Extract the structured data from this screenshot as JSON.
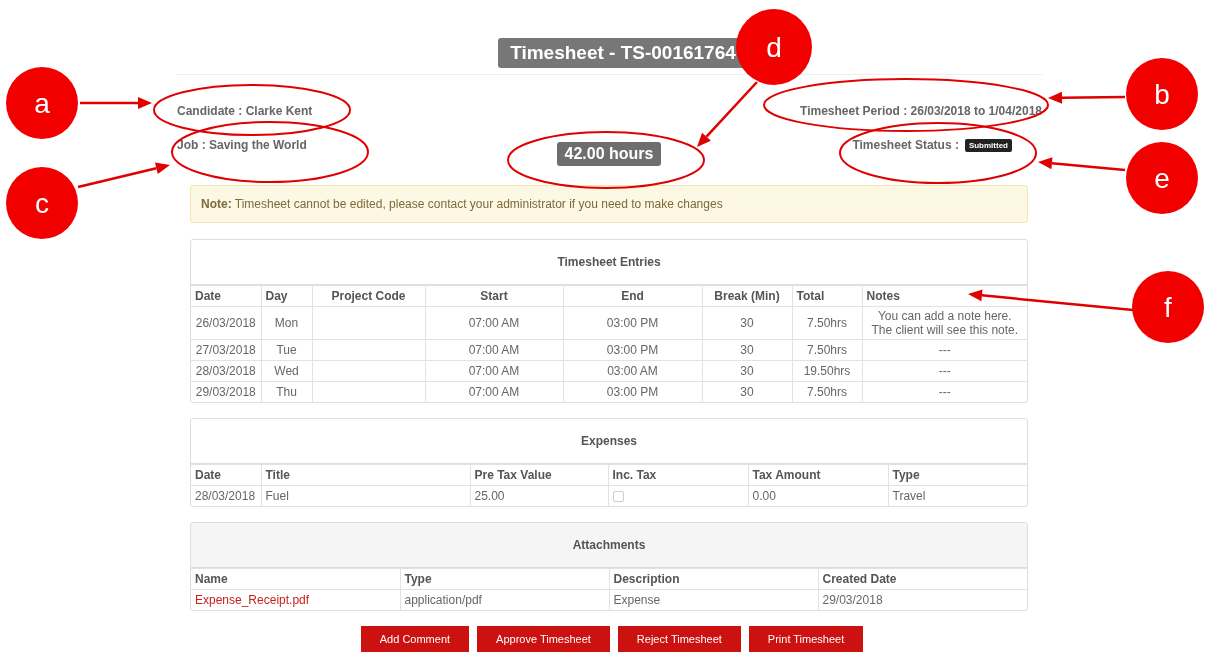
{
  "title": "Timesheet - TS-00161764",
  "candidate": "Candidate : Clarke Kent",
  "job": "Job : Saving the World",
  "period": "Timesheet Period :  26/03/2018 to 1/04/2018",
  "hours": "42.00 hours",
  "status": {
    "label": "Timesheet Status :",
    "badge": "Submitted"
  },
  "note": "**Note:** Timesheet cannot be edited, please contact your administrator if you need to make changes",
  "entries": {
    "title": "Timesheet Entries",
    "columns": [
      "Date",
      "Day",
      "Project Code",
      "Start",
      "End",
      "Break (Min)",
      "Total",
      "Notes"
    ],
    "rows": [
      [
        "26/03/2018",
        "Mon",
        "",
        "07:00 AM",
        "03:00 PM",
        "30",
        "7.50hrs",
        "You can add a note here.\nThe client will see this note."
      ],
      [
        "27/03/2018",
        "Tue",
        "",
        "07:00 AM",
        "03:00 PM",
        "30",
        "7.50hrs",
        "---"
      ],
      [
        "28/03/2018",
        "Wed",
        "",
        "07:00 AM",
        "03:00 AM",
        "30",
        "19.50hrs",
        "---"
      ],
      [
        "29/03/2018",
        "Thu",
        "",
        "07:00 AM",
        "03:00 PM",
        "30",
        "7.50hrs",
        "---"
      ]
    ]
  },
  "expenses": {
    "title": "Expenses",
    "columns": [
      "Date",
      "Title",
      "Pre Tax Value",
      "Inc. Tax",
      "Tax Amount",
      "Type"
    ],
    "rows": [
      {
        "date": "28/03/2018",
        "title": "Fuel",
        "pre_tax_value": "25.00",
        "inc_tax": false,
        "tax_amount": "0.00",
        "type": "Travel"
      }
    ]
  },
  "attachments": {
    "title": "Attachments",
    "columns": [
      "Name",
      "Type",
      "Description",
      "Created Date"
    ],
    "rows": [
      {
        "name": "Expense_Receipt.pdf",
        "type": "application/pdf",
        "description": "Expense",
        "created_date": "29/03/2018"
      }
    ]
  },
  "buttons": [
    "Add Comment",
    "Approve Timesheet",
    "Reject Timesheet",
    "Print Timesheet"
  ],
  "annotations": [
    {
      "label": "a"
    },
    {
      "label": "b"
    },
    {
      "label": "c"
    },
    {
      "label": "d"
    },
    {
      "label": "e"
    },
    {
      "label": "f"
    }
  ]
}
